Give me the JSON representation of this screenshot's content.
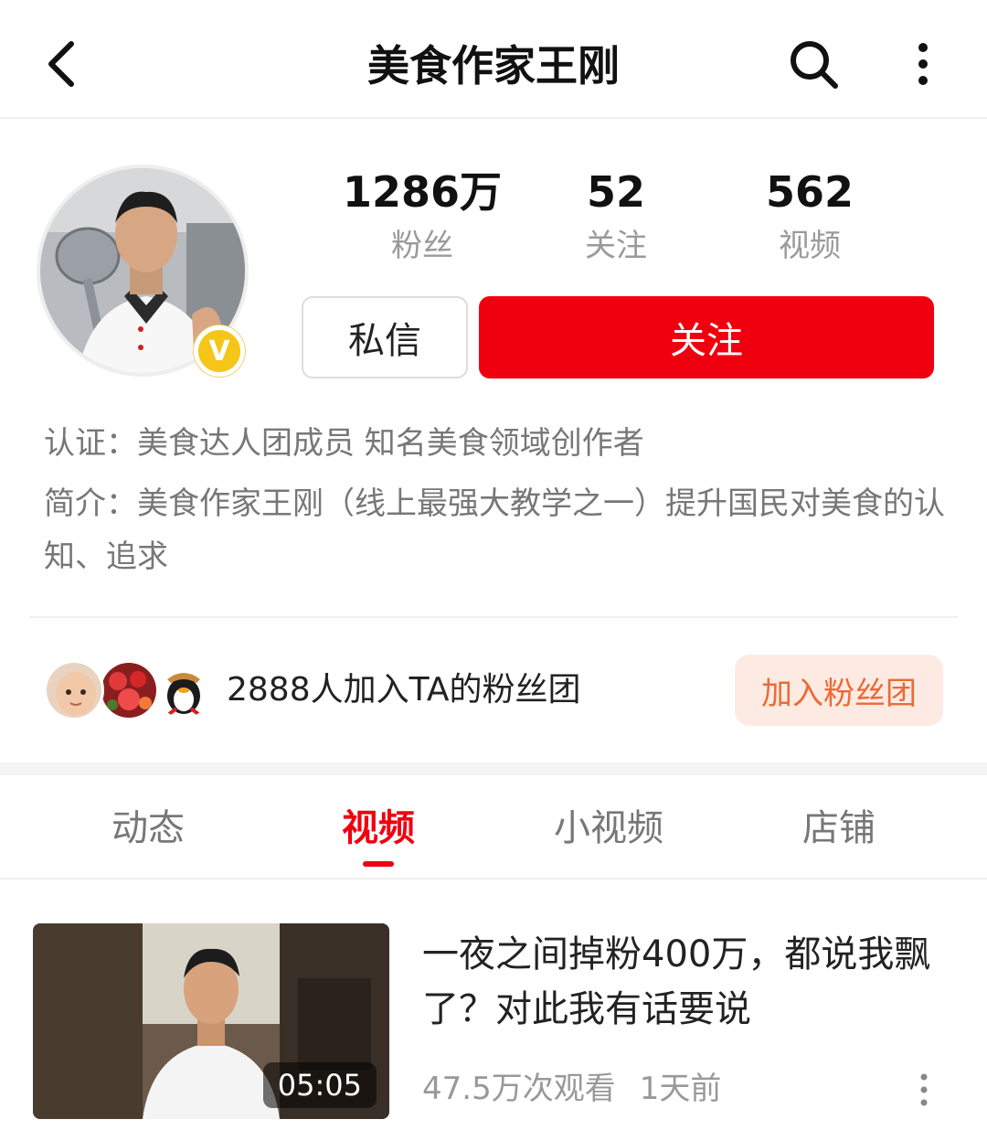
{
  "header": {
    "title": "美食作家王刚"
  },
  "profile": {
    "stats": [
      {
        "value": "1286万",
        "label": "粉丝"
      },
      {
        "value": "52",
        "label": "关注"
      },
      {
        "value": "562",
        "label": "视频"
      }
    ],
    "verified_badge": "V",
    "message_button": "私信",
    "follow_button": "关注",
    "certification": "认证：美食达人团成员 知名美食领域创作者",
    "intro": "简介：美食作家王刚（线上最强大教学之一）提升国民对美食的认知、追求"
  },
  "fans_group": {
    "text": "2888人加入TA的粉丝团",
    "join_button": "加入粉丝团"
  },
  "tabs": [
    {
      "label": "动态",
      "active": false
    },
    {
      "label": "视频",
      "active": true
    },
    {
      "label": "小视频",
      "active": false
    },
    {
      "label": "店铺",
      "active": false
    }
  ],
  "video": {
    "title": "一夜之间掉粉400万，都说我飘了？对此我有话要说",
    "duration": "05:05",
    "views": "47.5万次观看",
    "time": "1天前"
  },
  "colors": {
    "accent_red": "#f0000f",
    "join_orange": "#ec6a35",
    "join_bg": "#fdebe3",
    "muted_text": "#9a9a9a"
  },
  "icons": {
    "back": "back-arrow-icon",
    "search": "search-icon",
    "more": "more-vertical-icon",
    "verified": "verified-v-icon"
  }
}
